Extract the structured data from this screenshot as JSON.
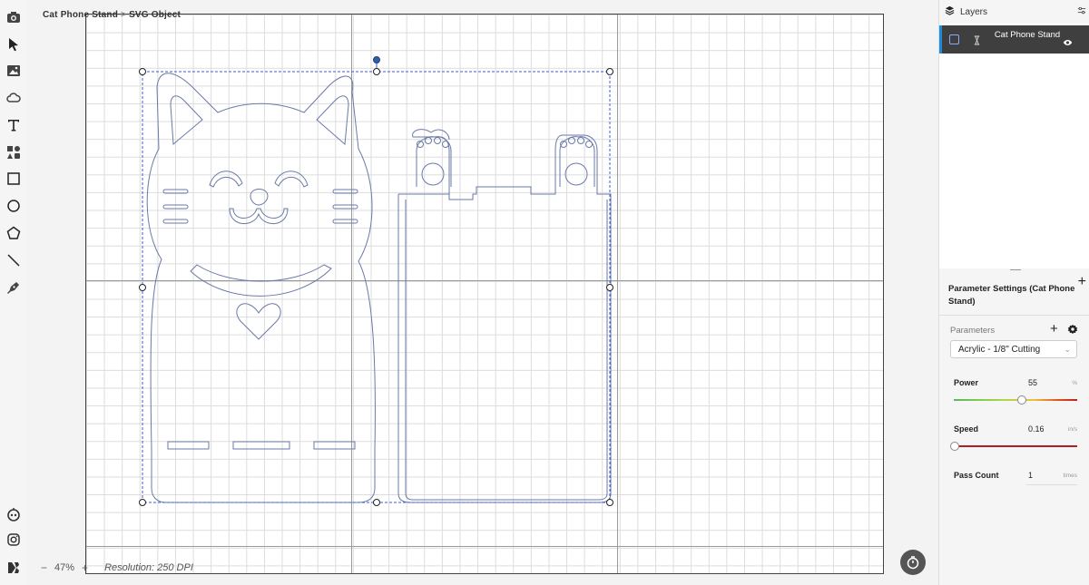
{
  "breadcrumb": {
    "project": "Cat Phone Stand",
    "separator": ">",
    "object": "SVG Object"
  },
  "toolbar": {
    "tools": [
      "camera-icon",
      "select-arrow-icon",
      "image-icon",
      "cloud-icon",
      "text-icon",
      "shapes-icon",
      "rectangle-icon",
      "circle-icon",
      "polygon-icon",
      "line-icon",
      "pen-icon"
    ],
    "bottom": [
      "robot-icon",
      "instagram-icon",
      "app-logo-icon"
    ]
  },
  "status": {
    "zoom_minus": "−",
    "zoom": "47%",
    "zoom_plus": "+",
    "resolution": "Resolution: 250 DPI"
  },
  "layers": {
    "title": "Layers",
    "items": [
      {
        "name": "Cat Phone Stand"
      }
    ],
    "add": "+"
  },
  "params": {
    "title": "Parameter Settings (Cat Phone Stand)",
    "label": "Parameters",
    "add": "+",
    "preset": "Acrylic - 1/8\" Cutting",
    "power": {
      "label": "Power",
      "value": "55",
      "unit": "%"
    },
    "speed": {
      "label": "Speed",
      "value": "0.16",
      "unit": "in/s"
    },
    "pass": {
      "label": "Pass Count",
      "value": "1",
      "unit": "times"
    }
  },
  "colors": {
    "accent": "#1f8bd9",
    "path": "#6a7aa8",
    "selection": "#3b5bdb",
    "layer_bg": "#3f3f3f"
  }
}
